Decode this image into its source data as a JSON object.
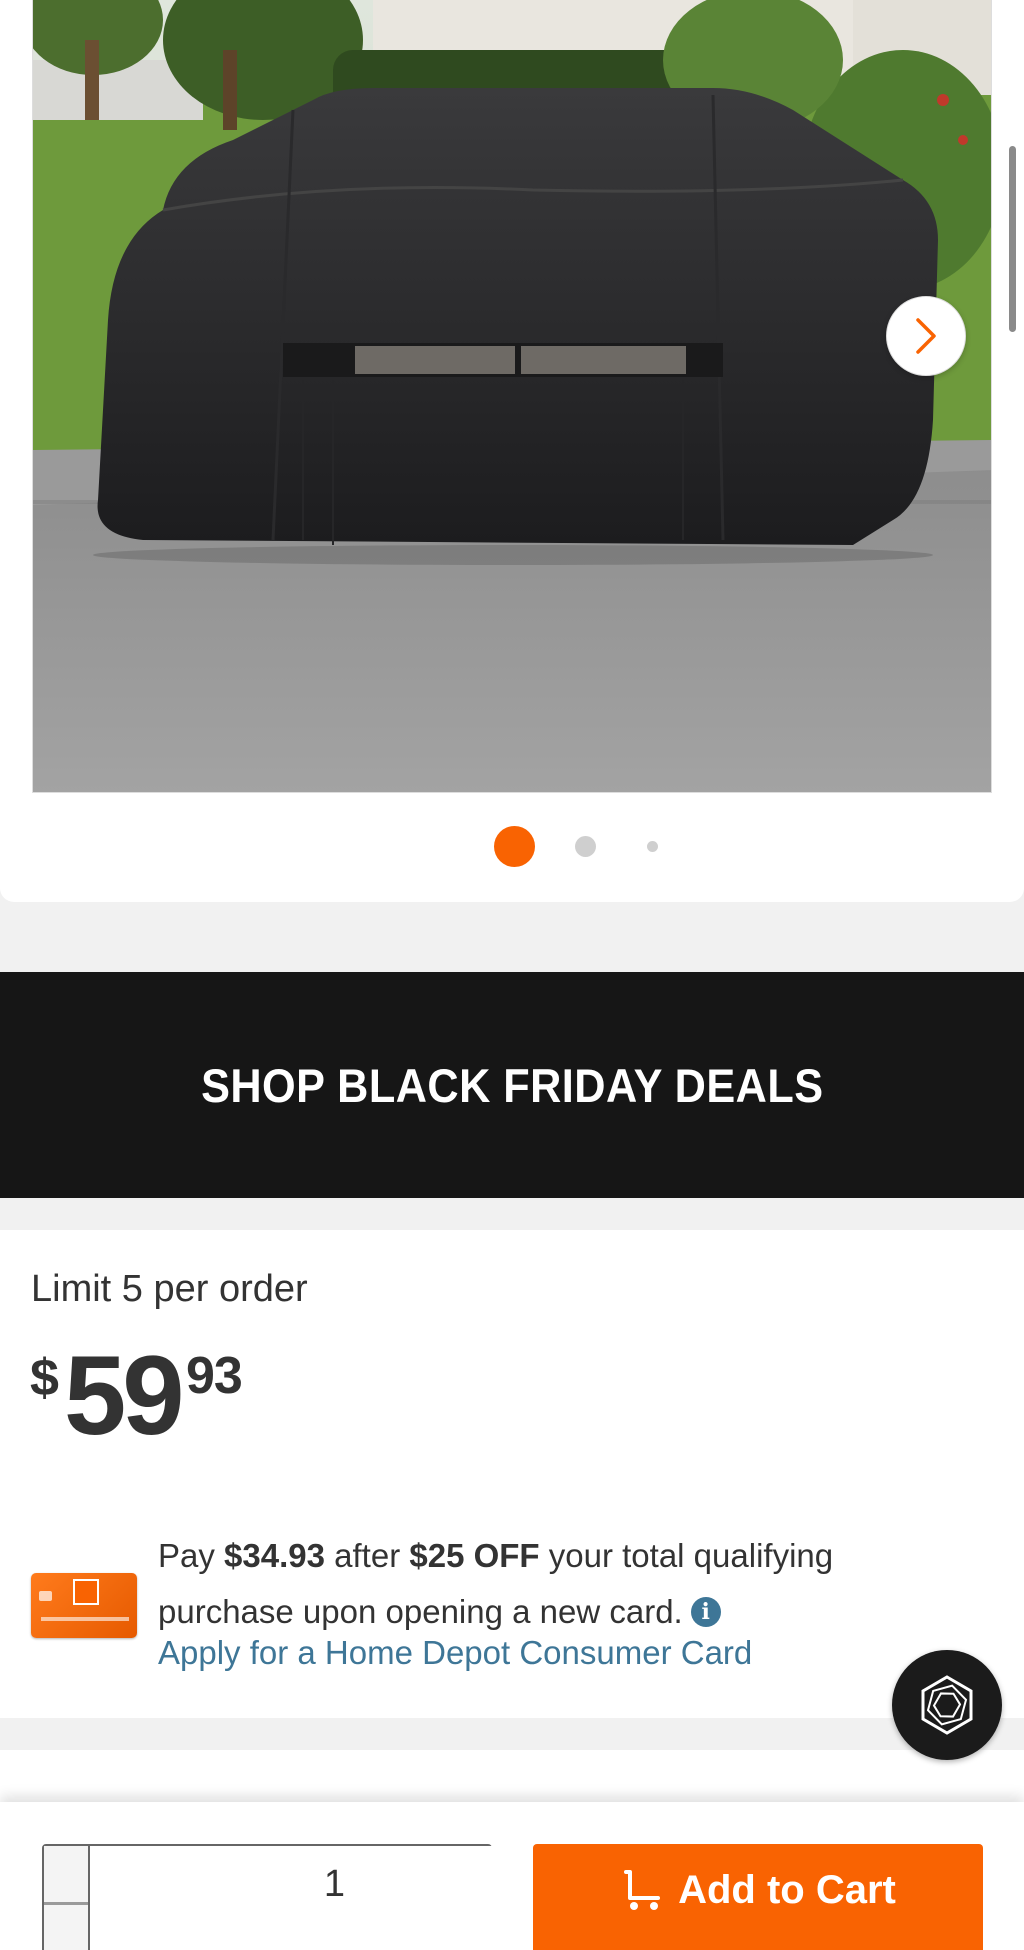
{
  "gallery": {
    "image_alt": "Black grill cover on grill in driveway",
    "next_icon": "chevron-right-icon",
    "active_index": 1,
    "total": 3
  },
  "banner": {
    "label": "SHOP BLACK FRIDAY DEALS"
  },
  "pricing": {
    "limit_text": "Limit 5 per order",
    "currency": "$",
    "dollars": "59",
    "cents": "93"
  },
  "card_offer": {
    "pay": "Pay",
    "discounted_price": "$34.93",
    "after": "after",
    "discount": "$25 OFF",
    "rest": "your total qualifying purchase upon opening a new card.",
    "info_icon": "info-icon",
    "apply_link": "Apply for a Home Depot Consumer Card"
  },
  "cart": {
    "quantity": "1",
    "minus_icon": "minus-icon",
    "plus_icon": "plus-icon",
    "add_label": "Add to Cart",
    "cart_icon": "cart-icon"
  },
  "colors": {
    "brand_orange": "#f96302",
    "banner_bg": "#161616",
    "link_blue": "#3e7697"
  }
}
